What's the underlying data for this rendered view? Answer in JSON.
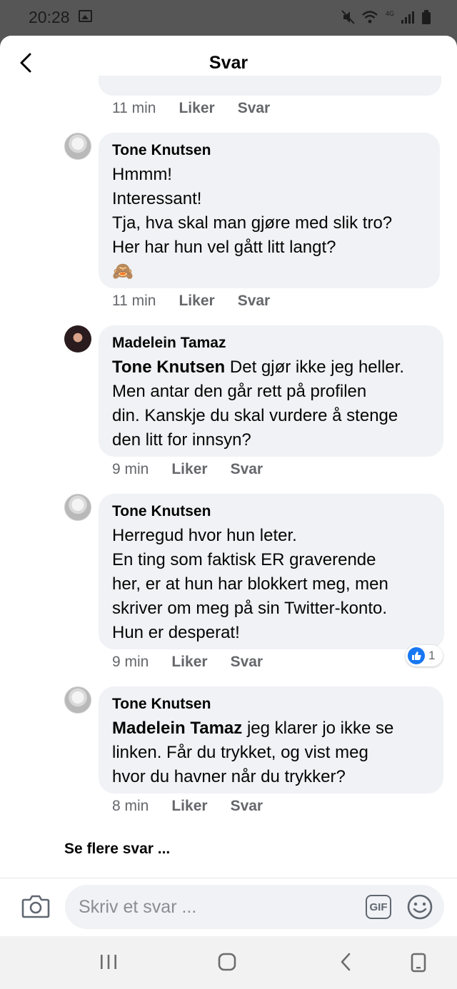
{
  "status_bar": {
    "time": "20:28",
    "network_label": "4G",
    "icons": [
      "image-icon",
      "mute-icon",
      "wifi-icon",
      "signal-icon",
      "battery-icon"
    ]
  },
  "header": {
    "title": "Svar",
    "back_icon": "chevron-left-icon"
  },
  "previous_comment": {
    "time": "11 min",
    "like": "Liker",
    "reply": "Svar"
  },
  "comments": [
    {
      "author": "Tone Knutsen",
      "mention": "",
      "text": "Hmmm!\nInteressant!\nTja, hva skal man gjøre med slik tro?\nHer har hun vel gått litt langt?\n🙈",
      "time": "11 min",
      "like": "Liker",
      "reply": "Svar"
    },
    {
      "author": "Madelein Tamaz",
      "mention": "Tone Knutsen",
      "text": " Det gjør ikke jeg heller.\nMen antar den går rett på profilen\ndin. Kanskje du skal vurdere å stenge\nden litt for innsyn?",
      "time": "9 min",
      "like": "Liker",
      "reply": "Svar"
    },
    {
      "author": "Tone Knutsen",
      "mention": "",
      "text": "Herregud hvor hun leter.\nEn ting som faktisk ER graverende\nher, er at hun har blokkert meg, men\nskriver om meg på sin Twitter-konto.\nHun er desperat!",
      "time": "9 min",
      "like": "Liker",
      "reply": "Svar",
      "reaction_count": "1"
    },
    {
      "author": "Tone Knutsen",
      "mention": "Madelein Tamaz",
      "text": " jeg klarer jo ikke se\nlinken. Får du trykket, og vist meg\nhvor du havner når du trykker?",
      "time": "8 min",
      "like": "Liker",
      "reply": "Svar"
    }
  ],
  "see_more": "Se flere svar ...",
  "composer": {
    "placeholder": "Skriv et svar ...",
    "gif_label": "GIF",
    "camera_icon": "camera-icon",
    "emoji_icon": "smiley-icon"
  },
  "nav_bar": {
    "icons": [
      "recent-apps-icon",
      "home-icon",
      "back-icon",
      "rotate-icon"
    ]
  }
}
